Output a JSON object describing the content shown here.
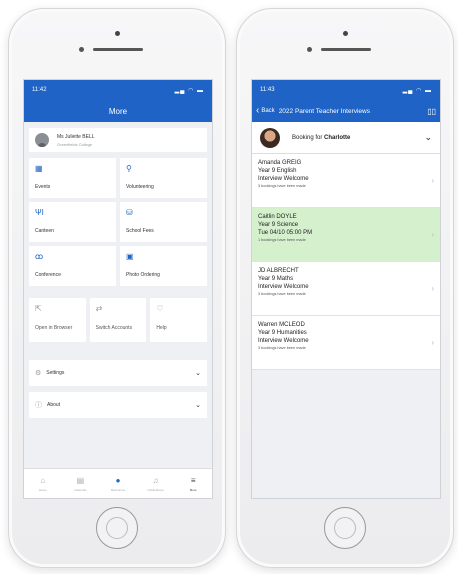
{
  "left_screen": {
    "status_time": "11:42",
    "title": "More",
    "user": {
      "name": "Ms Juliette BELL",
      "school": "Greenfields College"
    },
    "tiles": [
      {
        "icon": "calendar-icon",
        "label": "Events"
      },
      {
        "icon": "volunteering-icon",
        "label": "Volunteering"
      },
      {
        "icon": "canteen-icon",
        "label": "Canteen"
      },
      {
        "icon": "school-fees-icon",
        "label": "School Fees"
      },
      {
        "icon": "conference-icon",
        "label": "Conference"
      },
      {
        "icon": "photo-ordering-icon",
        "label": "Photo Ordering"
      }
    ],
    "small_tiles": [
      {
        "icon": "open-browser-icon",
        "label": "Open in Browser"
      },
      {
        "icon": "switch-accounts-icon",
        "label": "Switch Accounts"
      },
      {
        "icon": "help-icon",
        "label": "Help"
      }
    ],
    "settings_label": "Settings",
    "about_label": "About",
    "tabs": [
      {
        "icon": "home-icon",
        "label": "Home"
      },
      {
        "icon": "calendar-icon",
        "label": "Calendar"
      },
      {
        "icon": "add-icon",
        "label": "Resources"
      },
      {
        "icon": "bell-icon",
        "label": "Notifications"
      },
      {
        "icon": "menu-icon",
        "label": "More"
      }
    ]
  },
  "right_screen": {
    "status_time": "11:43",
    "back_label": "Back",
    "title": "2022 Parent Teacher Interviews",
    "booking_prefix": "Booking for",
    "booking_name": "Charlotte",
    "teachers": [
      {
        "name": "Amanda GREIG",
        "subject": "Year 9 English",
        "status": "Interview Welcome",
        "bookings": "3 bookings have been made",
        "highlight": false
      },
      {
        "name": "Caitlin DOYLE",
        "subject": "Year 9 Science",
        "status": "Tue 04/10 05:00 PM",
        "bookings": "1 bookings have been made",
        "highlight": true
      },
      {
        "name": "JD ALBRECHT",
        "subject": "Year 9 Maths",
        "status": "Interview Welcome",
        "bookings": "3 bookings have been made",
        "highlight": false
      },
      {
        "name": "Warren MCLEOD",
        "subject": "Year 9 Humanities",
        "status": "Interview Welcome",
        "bookings": "3 bookings have been made",
        "highlight": false
      }
    ]
  },
  "colors": {
    "brand": "#1e63c5",
    "highlight": "#d5f0cd"
  }
}
